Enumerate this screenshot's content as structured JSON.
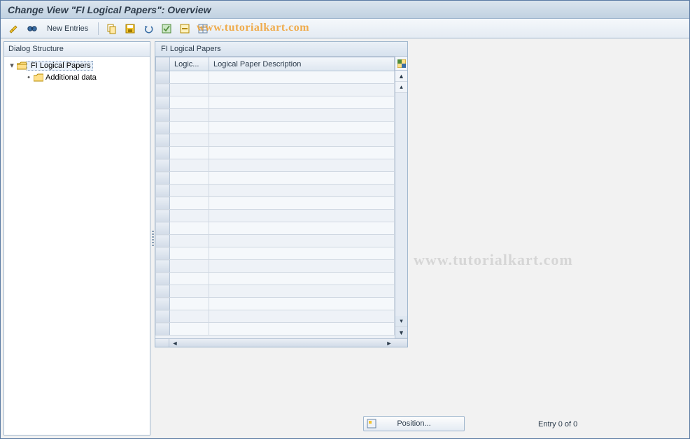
{
  "title": "Change View \"FI Logical Papers\": Overview",
  "watermark": "www.tutorialkart.com",
  "toolbar": {
    "new_entries_label": "New Entries"
  },
  "tree": {
    "header": "Dialog Structure",
    "root": {
      "label": "FI Logical Papers"
    },
    "child": {
      "label": "Additional data"
    }
  },
  "table": {
    "title": "FI Logical Papers",
    "columns": {
      "col1": "Logic...",
      "col2": "Logical Paper Description"
    },
    "row_count": 21
  },
  "footer": {
    "position_label": "Position...",
    "entry_text": "Entry 0 of 0"
  }
}
